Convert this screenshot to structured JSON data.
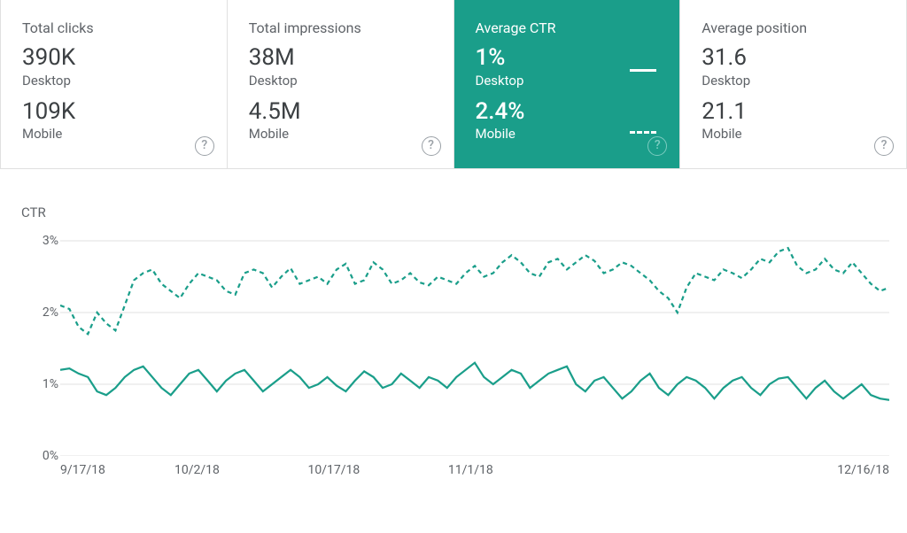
{
  "cards": [
    {
      "title": "Total clicks",
      "desktop_value": "390K",
      "desktop_label": "Desktop",
      "mobile_value": "109K",
      "mobile_label": "Mobile",
      "active": false
    },
    {
      "title": "Total impressions",
      "desktop_value": "38M",
      "desktop_label": "Desktop",
      "mobile_value": "4.5M",
      "mobile_label": "Mobile",
      "active": false
    },
    {
      "title": "Average CTR",
      "desktop_value": "1%",
      "desktop_label": "Desktop",
      "mobile_value": "2.4%",
      "mobile_label": "Mobile",
      "active": true
    },
    {
      "title": "Average position",
      "desktop_value": "31.6",
      "desktop_label": "Desktop",
      "mobile_value": "21.1",
      "mobile_label": "Mobile",
      "active": false
    }
  ],
  "help_glyph": "?",
  "chart": {
    "y_title": "CTR",
    "y_ticks": [
      "3%",
      "2%",
      "1%",
      "0%"
    ],
    "x_ticks": [
      {
        "label": "9/17/18",
        "pos": 0
      },
      {
        "label": "10/2/18",
        "pos": 16.5
      },
      {
        "label": "10/17/18",
        "pos": 33
      },
      {
        "label": "11/1/18",
        "pos": 49.5
      },
      {
        "label": "12/16/18",
        "pos": 100
      }
    ]
  },
  "chart_data": {
    "type": "line",
    "title": "CTR",
    "ylabel": "CTR",
    "ylim": [
      0,
      3
    ],
    "y_unit": "%",
    "x_range": [
      "9/17/18",
      "12/16/18"
    ],
    "series": [
      {
        "name": "Desktop",
        "style": "solid",
        "values": [
          1.2,
          1.22,
          1.15,
          1.1,
          0.9,
          0.85,
          0.95,
          1.1,
          1.2,
          1.25,
          1.1,
          0.95,
          0.85,
          1.0,
          1.15,
          1.2,
          1.05,
          0.9,
          1.05,
          1.15,
          1.2,
          1.05,
          0.9,
          1.0,
          1.1,
          1.2,
          1.1,
          0.95,
          1.0,
          1.1,
          0.98,
          0.9,
          1.05,
          1.18,
          1.1,
          0.95,
          1.0,
          1.15,
          1.05,
          0.95,
          1.1,
          1.05,
          0.95,
          1.1,
          1.2,
          1.3,
          1.1,
          1.0,
          1.1,
          1.2,
          1.15,
          0.95,
          1.05,
          1.15,
          1.2,
          1.25,
          1.0,
          0.9,
          1.05,
          1.1,
          0.95,
          0.8,
          0.9,
          1.05,
          1.15,
          0.95,
          0.85,
          1.0,
          1.1,
          1.05,
          0.95,
          0.8,
          0.95,
          1.05,
          1.1,
          0.95,
          0.85,
          1.0,
          1.08,
          1.1,
          0.95,
          0.8,
          0.95,
          1.05,
          0.9,
          0.8,
          0.9,
          1.0,
          0.85,
          0.8,
          0.78
        ]
      },
      {
        "name": "Mobile",
        "style": "dashed",
        "values": [
          2.1,
          2.05,
          1.8,
          1.7,
          2.0,
          1.85,
          1.75,
          2.1,
          2.45,
          2.55,
          2.6,
          2.4,
          2.3,
          2.2,
          2.4,
          2.55,
          2.5,
          2.45,
          2.3,
          2.25,
          2.55,
          2.6,
          2.55,
          2.35,
          2.5,
          2.62,
          2.4,
          2.45,
          2.5,
          2.4,
          2.6,
          2.68,
          2.4,
          2.45,
          2.7,
          2.6,
          2.4,
          2.45,
          2.55,
          2.42,
          2.38,
          2.5,
          2.45,
          2.4,
          2.55,
          2.65,
          2.5,
          2.55,
          2.7,
          2.8,
          2.7,
          2.55,
          2.5,
          2.7,
          2.75,
          2.6,
          2.7,
          2.8,
          2.72,
          2.55,
          2.6,
          2.7,
          2.65,
          2.55,
          2.45,
          2.3,
          2.2,
          2.0,
          2.35,
          2.55,
          2.5,
          2.45,
          2.6,
          2.55,
          2.48,
          2.6,
          2.75,
          2.7,
          2.85,
          2.9,
          2.65,
          2.55,
          2.6,
          2.75,
          2.6,
          2.55,
          2.7,
          2.55,
          2.4,
          2.3,
          2.35
        ]
      }
    ]
  }
}
